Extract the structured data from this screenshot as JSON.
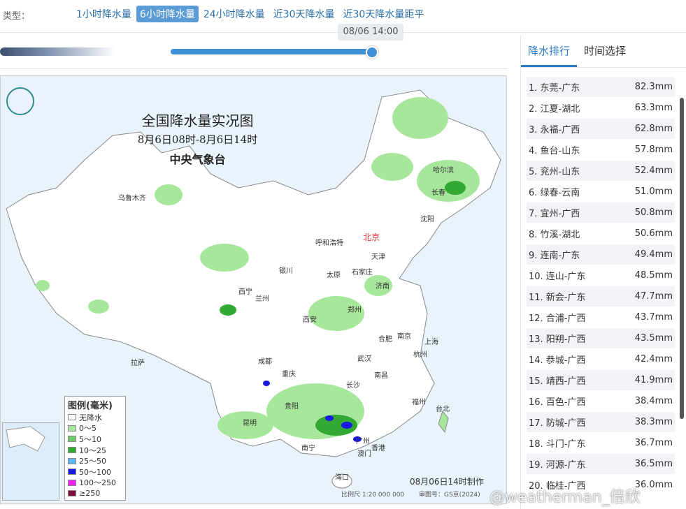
{
  "topbar": {
    "type_label": "类型：",
    "tabs": [
      {
        "label": "1小时降水量",
        "active": false
      },
      {
        "label": "6小时降水量",
        "active": true
      },
      {
        "label": "24小时降水量",
        "active": false
      },
      {
        "label": "近30天降水量",
        "active": false
      },
      {
        "label": "近30天降水量距平",
        "active": false
      }
    ]
  },
  "timeline": {
    "current_time": "08/06 14:00",
    "progress": 1.0
  },
  "map": {
    "title": "全国降水量实况图",
    "subtitle": "8月6日08时-8月6日14时",
    "agency": "中央气象台",
    "made_at": "08月06日14时制作",
    "scale": "比例尺 1:20 000 000",
    "audit": "审图号：GS京(2024)",
    "cities": [
      "乌鲁木齐",
      "哈尔滨",
      "长春",
      "沈阳",
      "呼和浩特",
      "北京",
      "天津",
      "银川",
      "太原",
      "石家庄",
      "济南",
      "西宁",
      "兰州",
      "郑州",
      "西安",
      "合肥",
      "南京",
      "上海",
      "武汉",
      "杭州",
      "成都",
      "重庆",
      "长沙",
      "南昌",
      "拉萨",
      "贵阳",
      "福州",
      "台北",
      "昆明",
      "南宁",
      "广州",
      "香港",
      "澳门",
      "海口"
    ],
    "legend": {
      "title": "图例(毫米)",
      "items": [
        {
          "label": "无降水",
          "color": "#ffffff"
        },
        {
          "label": "0～5",
          "color": "#a6e79c"
        },
        {
          "label": "5～10",
          "color": "#6ccc68"
        },
        {
          "label": "10～25",
          "color": "#33a833"
        },
        {
          "label": "25～50",
          "color": "#5fb5ee"
        },
        {
          "label": "50～100",
          "color": "#1a1ae6"
        },
        {
          "label": "100～250",
          "color": "#ee22ee"
        },
        {
          "label": "≥250",
          "color": "#7a1040"
        }
      ]
    }
  },
  "panel": {
    "tabs": [
      {
        "label": "降水排行",
        "active": true
      },
      {
        "label": "时间选择",
        "active": false
      }
    ],
    "ranking": [
      {
        "name": "1. 东莞-广东",
        "value": "82.3mm"
      },
      {
        "name": "2. 江夏-湖北",
        "value": "63.3mm"
      },
      {
        "name": "3. 永福-广西",
        "value": "62.8mm"
      },
      {
        "name": "4. 鱼台-山东",
        "value": "57.8mm"
      },
      {
        "name": "5. 兖州-山东",
        "value": "52.4mm"
      },
      {
        "name": "6. 绿春-云南",
        "value": "51.0mm"
      },
      {
        "name": "7. 宜州-广西",
        "value": "50.8mm"
      },
      {
        "name": "8. 竹溪-湖北",
        "value": "50.6mm"
      },
      {
        "name": "9. 连南-广东",
        "value": "49.4mm"
      },
      {
        "name": "10. 连山-广东",
        "value": "48.5mm"
      },
      {
        "name": "11. 新会-广东",
        "value": "47.7mm"
      },
      {
        "name": "12. 合浦-广西",
        "value": "43.7mm"
      },
      {
        "name": "13. 阳朔-广西",
        "value": "43.5mm"
      },
      {
        "name": "14. 恭城-广西",
        "value": "42.4mm"
      },
      {
        "name": "15. 靖西-广西",
        "value": "41.9mm"
      },
      {
        "name": "16. 百色-广西",
        "value": "38.4mm"
      },
      {
        "name": "17. 防城-广西",
        "value": "38.3mm"
      },
      {
        "name": "18. 斗门-广东",
        "value": "36.7mm"
      },
      {
        "name": "19. 河源-广东",
        "value": "36.5mm"
      },
      {
        "name": "20. 临桂-广西",
        "value": "36.0mm"
      }
    ]
  },
  "watermark": "@weatherman_倍欣"
}
